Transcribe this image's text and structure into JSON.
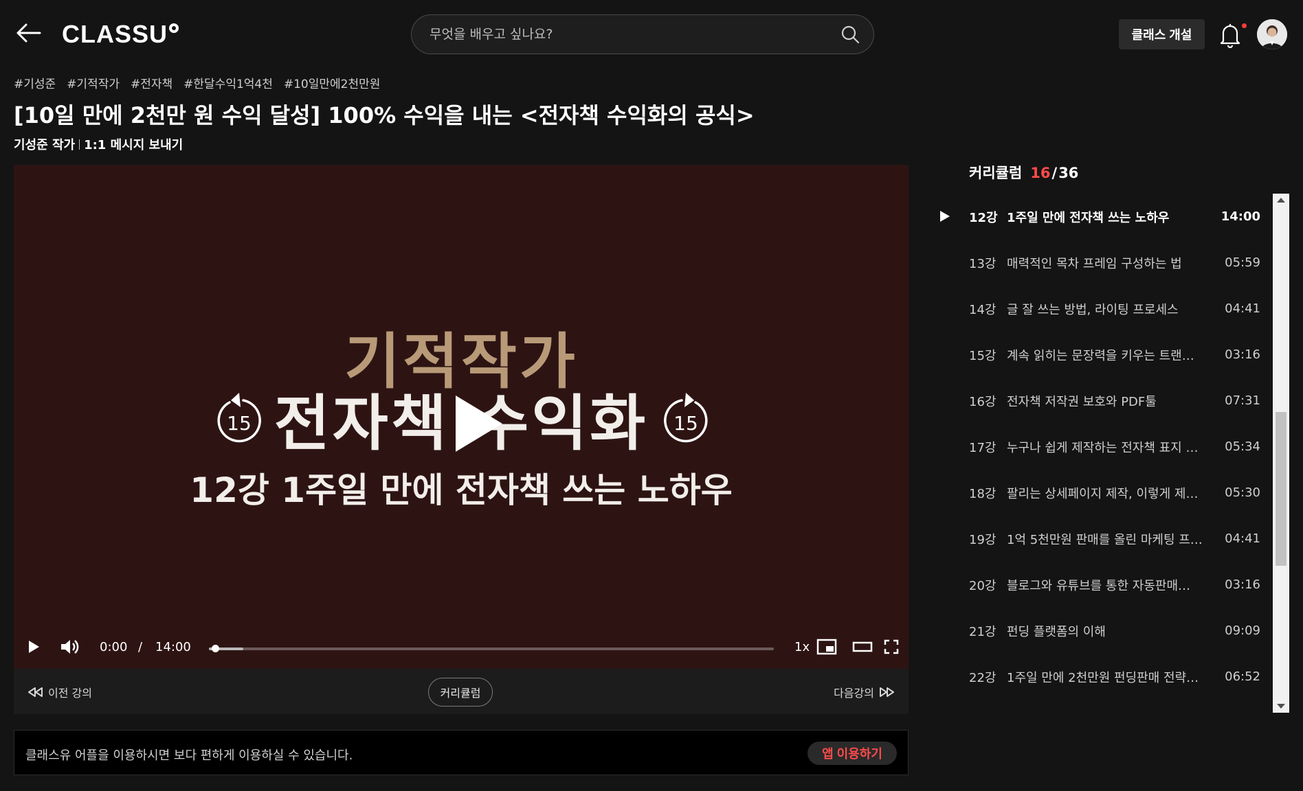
{
  "header": {
    "logo": "CLASSU",
    "search_placeholder": "무엇을 배우고 싶나요?",
    "open_class_label": "클래스 개설"
  },
  "course": {
    "tags": [
      "#기성준",
      "#기적작가",
      "#전자책",
      "#한달수익1억4천",
      "#10일만에2천만원"
    ],
    "title": "[10일 만에 2천만 원 수익 달성] 100% 수익을 내는 <전자책 수익화의 공식>",
    "author": "기성준 작가",
    "message_link": "1:1 메시지 보내기"
  },
  "video": {
    "title_line1": "기적작가",
    "title_line2": "전자책 수익화",
    "title_line3": "12강 1주일 만에 전자책 쓰는 노하우",
    "skip_back": "15",
    "skip_forward": "15",
    "current_time": "0:00",
    "time_separator": "/",
    "duration": "14:00",
    "speed": "1x",
    "progress": 0
  },
  "nav": {
    "prev_label": "이전 강의",
    "curriculum_label": "커리큘럼",
    "next_label": "다음강의"
  },
  "app_banner": {
    "text": "클래스유 어플을 이용하시면 보다 편하게 이용하실 수 있습니다.",
    "button_label": "앱 이용하기"
  },
  "curriculum": {
    "label": "커리큘럼",
    "current": "16",
    "separator": "/",
    "total": "36",
    "lectures": [
      {
        "num": "12강",
        "title": "1주일 만에 전자책 쓰는 노하우",
        "duration": "14:00"
      },
      {
        "num": "13강",
        "title": "매력적인 목차 프레임 구성하는 법",
        "duration": "05:59"
      },
      {
        "num": "14강",
        "title": "글 잘 쓰는 방법, 라이팅 프로세스",
        "duration": "04:41"
      },
      {
        "num": "15강",
        "title": "계속 읽히는 문장력을 키우는 트랜…",
        "duration": "03:16"
      },
      {
        "num": "16강",
        "title": "전자책 저작권 보호와 PDF툴",
        "duration": "07:31"
      },
      {
        "num": "17강",
        "title": "누구나 쉽게 제작하는 전자책 표지 …",
        "duration": "05:34"
      },
      {
        "num": "18강",
        "title": "팔리는 상세페이지 제작, 이렇게 제…",
        "duration": "05:30"
      },
      {
        "num": "19강",
        "title": "1억 5천만원 판매를 올린 마케팅 프…",
        "duration": "04:41"
      },
      {
        "num": "20강",
        "title": "블로그와 유튜브를 통한 자동판매…",
        "duration": "03:16"
      },
      {
        "num": "21강",
        "title": "펀딩 플랫폼의 이해",
        "duration": "09:09"
      },
      {
        "num": "22강",
        "title": "1주일 만에 2천만원 펀딩판매 전략…",
        "duration": "06:52"
      }
    ]
  }
}
